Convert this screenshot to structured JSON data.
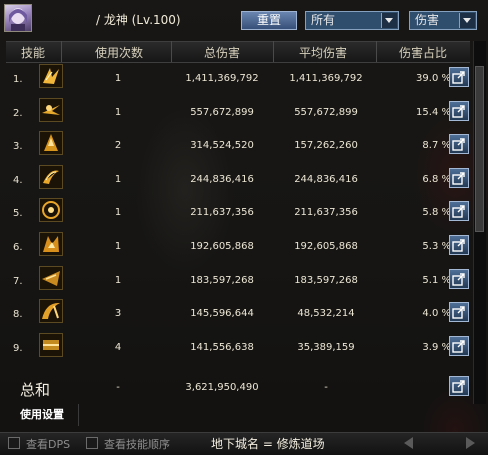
{
  "header": {
    "title": "/ 龙神 (Lv.100)",
    "reset_label": "重置",
    "filter_select": "所有",
    "metric_select": "伤害"
  },
  "columns": [
    "技能",
    "使用次数",
    "总伤害",
    "平均伤害",
    "伤害占比"
  ],
  "rows": [
    {
      "index": "1.",
      "skill_icon": "skill-1-icon",
      "uses": "1",
      "total": "1,411,369,792",
      "average": "1,411,369,792",
      "share": "39.0 %"
    },
    {
      "index": "2.",
      "skill_icon": "skill-2-icon",
      "uses": "1",
      "total": "557,672,899",
      "average": "557,672,899",
      "share": "15.4 %"
    },
    {
      "index": "3.",
      "skill_icon": "skill-3-icon",
      "uses": "2",
      "total": "314,524,520",
      "average": "157,262,260",
      "share": "8.7 %"
    },
    {
      "index": "4.",
      "skill_icon": "skill-4-icon",
      "uses": "1",
      "total": "244,836,416",
      "average": "244,836,416",
      "share": "6.8 %"
    },
    {
      "index": "5.",
      "skill_icon": "skill-5-icon",
      "uses": "1",
      "total": "211,637,356",
      "average": "211,637,356",
      "share": "5.8 %"
    },
    {
      "index": "6.",
      "skill_icon": "skill-6-icon",
      "uses": "1",
      "total": "192,605,868",
      "average": "192,605,868",
      "share": "5.3 %"
    },
    {
      "index": "7.",
      "skill_icon": "skill-7-icon",
      "uses": "1",
      "total": "183,597,268",
      "average": "183,597,268",
      "share": "5.1 %"
    },
    {
      "index": "8.",
      "skill_icon": "skill-8-icon",
      "uses": "3",
      "total": "145,596,644",
      "average": "48,532,214",
      "share": "4.0 %"
    },
    {
      "index": "9.",
      "skill_icon": "skill-9-icon",
      "uses": "4",
      "total": "141,556,638",
      "average": "35,389,159",
      "share": "3.9 %"
    }
  ],
  "total": {
    "label": "总和",
    "uses": "-",
    "total": "3,621,950,490",
    "average": "-"
  },
  "footer": {
    "settings_tab": "使用设置",
    "show_dps_label": "查看DPS",
    "show_skill_order_label": "查看技能顺序",
    "location": "地下城名 = 修炼道场"
  },
  "colors": {
    "accent_button": "#4a6a98",
    "select_bg": "#2f4d6d",
    "skill_icon_gold": "#e0a62a"
  }
}
